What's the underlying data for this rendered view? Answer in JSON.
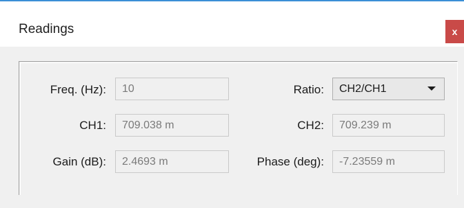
{
  "window": {
    "title": "Readings",
    "close_label": "x",
    "accent_color": "#3a8fd6",
    "close_color": "#c94a48"
  },
  "readings": {
    "freq_label": "Freq. (Hz):",
    "freq_value": "10",
    "ratio_label": "Ratio:",
    "ratio_selected": "CH2/CH1",
    "ch1_label": "CH1:",
    "ch1_value": "709.038 m",
    "ch2_label": "CH2:",
    "ch2_value": "709.239 m",
    "gain_label": "Gain (dB):",
    "gain_value": "2.4693 m",
    "phase_label": "Phase (deg):",
    "phase_value": "-7.23559 m"
  }
}
